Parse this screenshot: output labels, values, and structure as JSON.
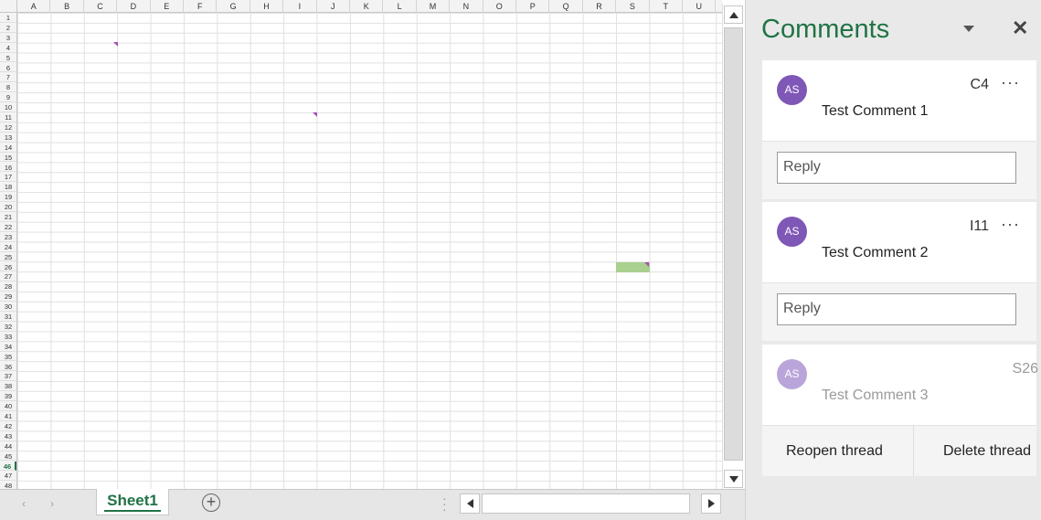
{
  "spreadsheet": {
    "columns": [
      "A",
      "B",
      "C",
      "D",
      "E",
      "F",
      "G",
      "H",
      "I",
      "J",
      "K",
      "L",
      "M",
      "N",
      "O",
      "P",
      "Q",
      "R",
      "S",
      "T",
      "U"
    ],
    "rows": [
      "1",
      "2",
      "3",
      "4",
      "5",
      "6",
      "7",
      "8",
      "9",
      "10",
      "11",
      "12",
      "13",
      "14",
      "15",
      "16",
      "17",
      "18",
      "19",
      "20",
      "21",
      "22",
      "23",
      "24",
      "25",
      "26",
      "27",
      "28",
      "29",
      "30",
      "31",
      "32",
      "33",
      "34",
      "35",
      "36",
      "37",
      "38",
      "39",
      "40",
      "41",
      "42",
      "43",
      "44",
      "45",
      "46",
      "47",
      "48"
    ],
    "active_row": "46",
    "comment_marker_color": "#a64fb4",
    "selected_cell_color": "#a9d08e"
  },
  "tabbar": {
    "sheet_tab_label": "Sheet1",
    "add_sheet_symbol": "+",
    "prev_sheet_icon": "‹",
    "next_sheet_icon": "›"
  },
  "comments_pane": {
    "title": "Comments",
    "accent_color": "#217346",
    "threads": [
      {
        "initials": "AS",
        "cell_ref": "C4",
        "text": "Test Comment 1",
        "reply_placeholder": "Reply",
        "more": "···"
      },
      {
        "initials": "AS",
        "cell_ref": "I11",
        "text": "Test Comment 2",
        "reply_placeholder": "Reply",
        "more": "···"
      },
      {
        "initials": "AS",
        "cell_ref": "S26",
        "text": "Test Comment 3",
        "resolved": true
      }
    ],
    "actions": {
      "reopen_label": "Reopen thread",
      "delete_label": "Delete thread"
    }
  }
}
